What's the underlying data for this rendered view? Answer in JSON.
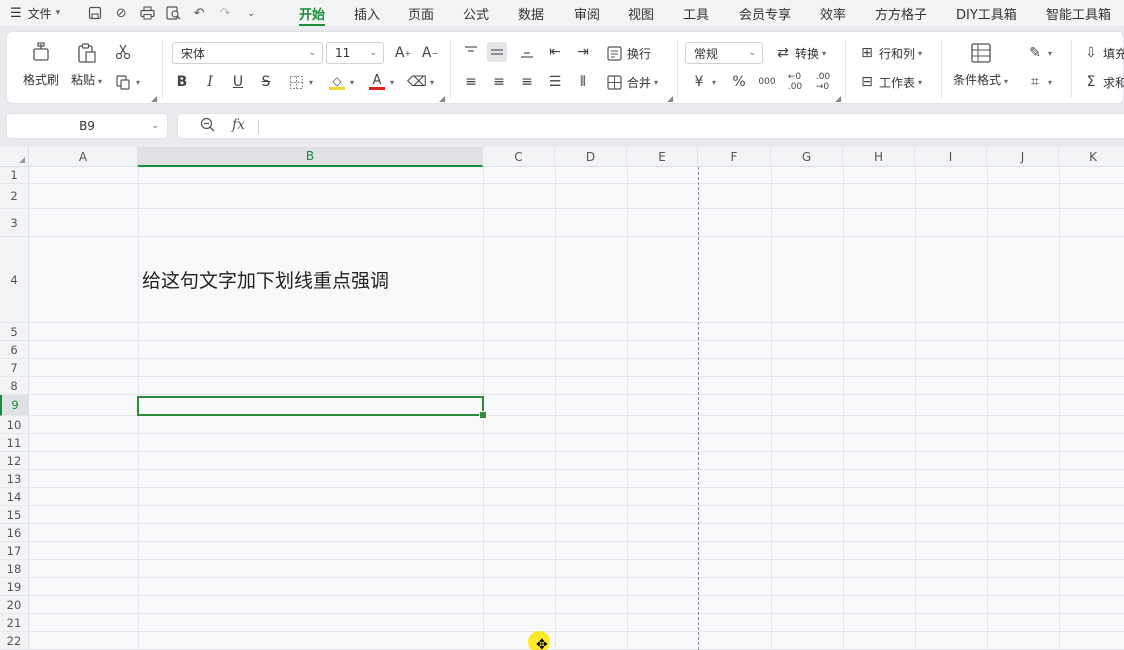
{
  "menubar": {
    "file_label": "文件",
    "tabs": [
      "开始",
      "插入",
      "页面",
      "公式",
      "数据",
      "审阅",
      "视图",
      "工具",
      "会员专享",
      "效率",
      "方方格子",
      "DIY工具箱",
      "智能工具箱"
    ],
    "active_tab": "开始"
  },
  "ribbon": {
    "format_painter": "格式刷",
    "paste": "粘贴",
    "font_name": "宋体",
    "font_size": "11",
    "wrap": "换行",
    "merge": "合并",
    "number_format": "常规",
    "convert": "转换",
    "rows_cols": "行和列",
    "worksheet": "工作表",
    "cond_format": "条件格式",
    "fill": "填充",
    "sum": "求和",
    "currency_symbol": "¥",
    "percent_symbol": "%",
    "thousands_symbol": "000",
    "bold": "B",
    "italic": "I",
    "underline": "U",
    "strike": "S",
    "font_color_letter": "A",
    "font_color": "#e0211d",
    "fill_color": "#f5d533"
  },
  "formula": {
    "name_box": "B9",
    "fx_label": "fx",
    "value": ""
  },
  "sheet": {
    "columns": [
      "A",
      "B",
      "C",
      "D",
      "E",
      "F",
      "G",
      "H",
      "I",
      "J",
      "K"
    ],
    "selected_column": "B",
    "rows": [
      "1",
      "2",
      "3",
      "4",
      "5",
      "6",
      "7",
      "8",
      "9",
      "10",
      "11",
      "12",
      "13",
      "14",
      "15",
      "16",
      "17",
      "18",
      "19",
      "20",
      "21",
      "22"
    ],
    "selected_row": "9",
    "cell_b4": "给这句文字加下划线重点强调",
    "accent": "#1a8c3b"
  }
}
